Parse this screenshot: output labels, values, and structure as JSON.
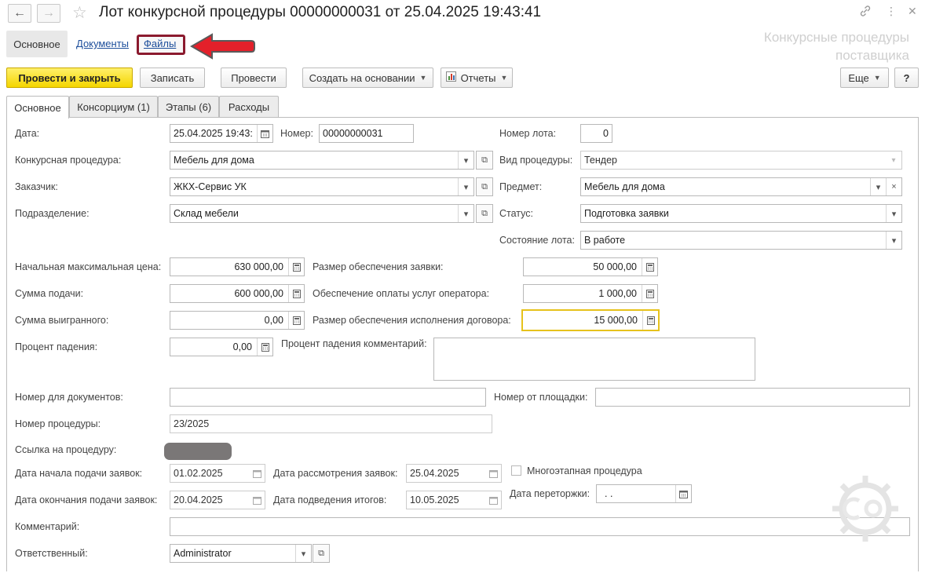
{
  "window": {
    "title": "Лот конкурсной процедуры 00000000031 от 25.04.2025 19:43:41",
    "brand_line1": "Конкурсные процедуры",
    "brand_line2": "поставщика"
  },
  "sections": {
    "main": "Основное",
    "documents": "Документы",
    "files": "Файлы"
  },
  "toolbar": {
    "post_close": "Провести и закрыть",
    "save": "Записать",
    "post": "Провести",
    "create_based": "Создать на основании",
    "reports": "Отчеты",
    "more": "Еще",
    "help": "?"
  },
  "tabs": [
    "Основное",
    "Консорциум (1)",
    "Этапы (6)",
    "Расходы"
  ],
  "form": {
    "date_label": "Дата:",
    "date_value": "25.04.2025 19:43:",
    "number_label": "Номер:",
    "number_value": "00000000031",
    "lot_number_label": "Номер лота:",
    "lot_number_value": "0",
    "procedure_label": "Конкурсная процедура:",
    "procedure_value": "Мебель для дома",
    "procedure_kind_label": "Вид процедуры:",
    "procedure_kind_value": "Тендер",
    "customer_label": "Заказчик:",
    "customer_value": "ЖКХ-Сервис УК",
    "subject_label": "Предмет:",
    "subject_value": "Мебель для дома",
    "division_label": "Подразделение:",
    "division_value": "Склад мебели",
    "status_label": "Статус:",
    "status_value": "Подготовка заявки",
    "lot_state_label": "Состояние лота:",
    "lot_state_value": "В работе",
    "max_price_label": "Начальная максимальная цена:",
    "max_price_value": "630 000,00",
    "bid_security_label": "Размер обеспечения заявки:",
    "bid_security_value": "50 000,00",
    "submit_sum_label": "Сумма подачи:",
    "submit_sum_value": "600 000,00",
    "operator_security_label": "Обеспечение оплаты услуг оператора:",
    "operator_security_value": "1 000,00",
    "won_sum_label": "Сумма выигранного:",
    "won_sum_value": "0,00",
    "contract_security_label": "Размер обеспечения исполнения договора:",
    "contract_security_value": "15 000,00",
    "drop_percent_label": "Процент падения:",
    "drop_percent_value": "0,00",
    "drop_comment_label": "Процент падения комментарий:",
    "drop_comment_value": "",
    "doc_number_label": "Номер для документов:",
    "doc_number_value": "",
    "platform_number_label": "Номер от площадки:",
    "platform_number_value": "",
    "procedure_number_label": "Номер процедуры:",
    "procedure_number_value": "23/2025",
    "procedure_link_label": "Ссылка на процедуру:",
    "apply_start_label": "Дата начала подачи заявок:",
    "apply_start_value": "01.02.2025",
    "review_date_label": "Дата рассмотрения заявок:",
    "review_date_value": "25.04.2025",
    "multistage_label": "Многоэтапная процедура",
    "apply_end_label": "Дата окончания подачи заявок:",
    "apply_end_value": "20.04.2025",
    "results_date_label": "Дата подведения итогов:",
    "results_date_value": "10.05.2025",
    "rebid_date_label": "Дата переторжки:",
    "rebid_date_value": " .  .",
    "comment_label": "Комментарий:",
    "comment_value": "",
    "responsible_label": "Ответственный:",
    "responsible_value": "Administrator"
  },
  "colors": {
    "primary_button": "#f4d500",
    "files_highlight": "#8b1a2e",
    "arrow": "#e3202a",
    "link": "#1d4e9b",
    "focus_border": "#e6c21c"
  }
}
